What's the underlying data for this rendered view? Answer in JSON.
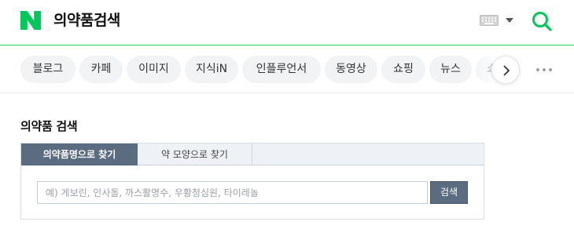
{
  "header": {
    "logo_letter": "N",
    "title": "의약품검색",
    "brand_color": "#03c75a",
    "icons": [
      "keyboard-icon",
      "caret-down-icon",
      "search-icon"
    ]
  },
  "tabs": [
    {
      "label": "블로그"
    },
    {
      "label": "카페"
    },
    {
      "label": "이미지"
    },
    {
      "label": "지식iN"
    },
    {
      "label": "인플루언서"
    },
    {
      "label": "동영상"
    },
    {
      "label": "쇼핑"
    },
    {
      "label": "뉴스"
    },
    {
      "label": "쇼"
    }
  ],
  "section": {
    "title": "의약품 검색",
    "tabs": [
      "의약품명으로 찾기",
      "약 모양으로 찾기"
    ],
    "active_tab": 0,
    "input": {
      "placeholder": "예) 게보린, 인사돌, 까스활명수, 우황청심원, 타이레놀",
      "value": ""
    },
    "search_button": "검색",
    "accent_color": "#5b6b80"
  }
}
